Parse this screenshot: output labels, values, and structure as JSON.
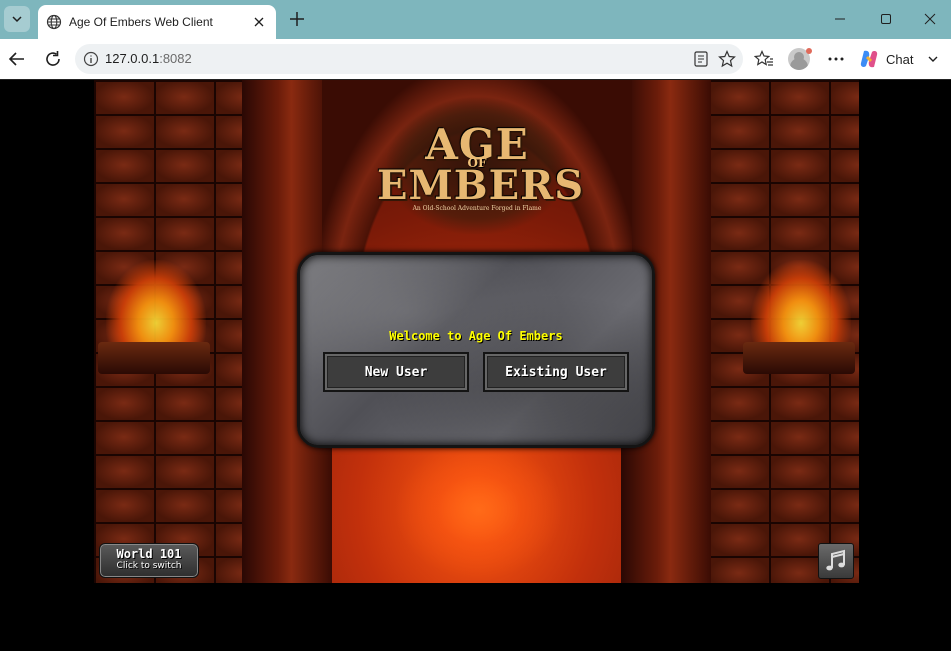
{
  "browser": {
    "tab_title": "Age Of Embers Web Client",
    "url_host": "127.0.0.1",
    "url_port": ":8082",
    "chat_label": "Chat"
  },
  "game": {
    "logo": {
      "line1": "AGE",
      "line2": "OF",
      "line3": "EMBERS",
      "tagline": "An Old-School Adventure Forged in Flame"
    },
    "welcome_text": "Welcome to Age Of Embers",
    "new_user_label": "New User",
    "existing_user_label": "Existing User",
    "world_title": "World 101",
    "world_subtitle": "Click to switch"
  },
  "icons": {
    "tab_list": "chevron-down-icon",
    "tab_favicon": "globe-icon",
    "tab_close": "close-icon",
    "new_tab": "plus-icon",
    "back": "back-arrow-icon",
    "reload": "reload-icon",
    "site_info": "info-icon",
    "reader": "reader-mode-icon",
    "favorite": "star-icon",
    "favorites": "favorites-icon",
    "more": "more-icon",
    "music": "music-note-icon"
  },
  "colors": {
    "tabbar": "#7eb6bd",
    "welcome_text": "#ffff00",
    "panel_stone": "#5a5a60"
  }
}
